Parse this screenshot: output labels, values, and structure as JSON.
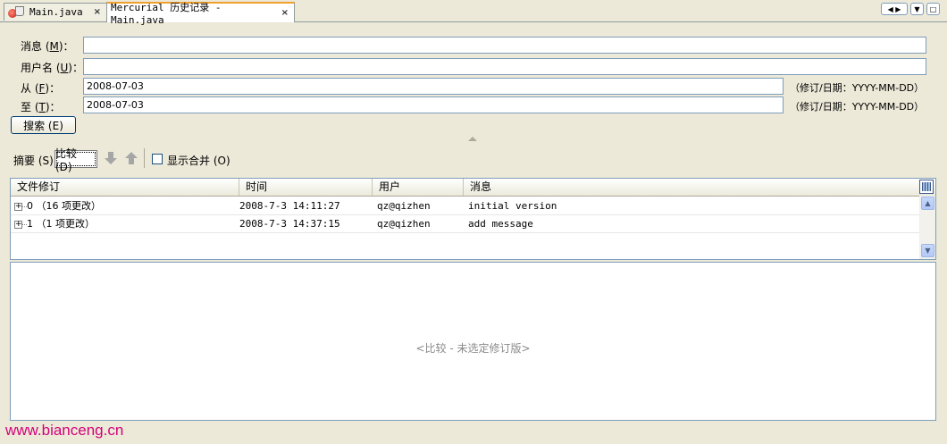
{
  "tabs": [
    {
      "label": "Main.java",
      "close": "×"
    },
    {
      "label": "Mercurial 历史记录 - Main.java",
      "close": "×"
    }
  ],
  "nav_buttons": {
    "prev": "◀",
    "next": "▶",
    "menu": "▼",
    "maximize": "□"
  },
  "form": {
    "message": {
      "label_prefix": "消息 (",
      "mnemonic": "M",
      "label_suffix": ")：",
      "value": ""
    },
    "username": {
      "label_prefix": "用户名 (",
      "mnemonic": "U",
      "label_suffix": ")：",
      "value": ""
    },
    "from": {
      "label_prefix": "从 (",
      "mnemonic": "F",
      "label_suffix": ")：",
      "value": "2008-07-03",
      "hint": "（修订/日期：YYYY-MM-DD）"
    },
    "to": {
      "label_prefix": "至 (",
      "mnemonic": "T",
      "label_suffix": ")：",
      "value": "2008-07-03",
      "hint": "（修订/日期：YYYY-MM-DD）"
    },
    "search_button": "搜索 (E)"
  },
  "toolbar": {
    "summary_label": "摘要 (S)",
    "compare_label": "比较 (D)",
    "show_merges_label": "显示合并 (O)",
    "show_merges_checked": false
  },
  "table": {
    "columns": [
      "文件修订",
      "时间",
      "用户",
      "消息"
    ],
    "rows": [
      {
        "revision": "0 （16 项更改）",
        "time": "2008-7-3 14:11:27",
        "user": "qz@qizhen",
        "message": "initial version"
      },
      {
        "revision": "1 （1 项更改）",
        "time": "2008-7-3 14:37:15",
        "user": "qz@qizhen",
        "message": "add message"
      }
    ],
    "expander_symbol": "+"
  },
  "diff_pane": {
    "placeholder": "<比较 - 未选定修订版>"
  },
  "watermark": "www.bianceng.cn",
  "colors": {
    "active_tab_accent": "#f0a030",
    "watermark": "#d4007a",
    "background": "#ece9d8"
  }
}
